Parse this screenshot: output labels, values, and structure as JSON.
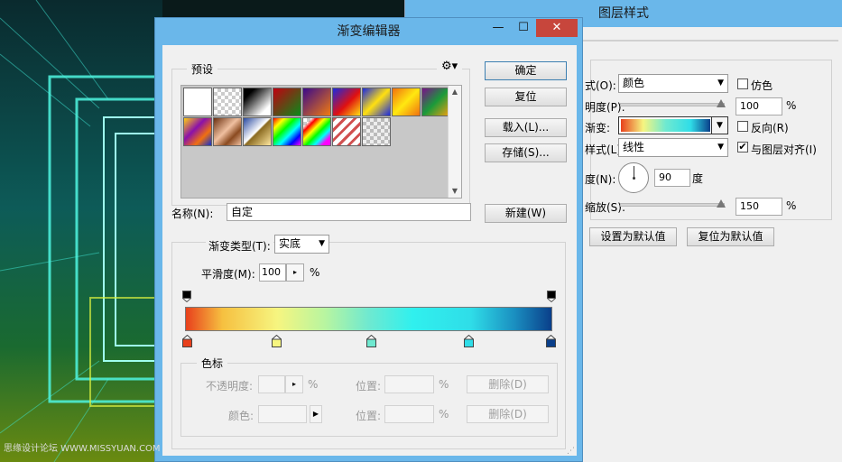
{
  "layer_style": {
    "title": "图层样式",
    "blend_mode_label": "式(O):",
    "blend_mode_value": "颜色",
    "dither_label": "仿色",
    "opacity_label": "明度(P):",
    "opacity_value": "100",
    "percent": "%",
    "gradient_label": "渐变:",
    "reverse_label": "反向(R)",
    "style_label": "样式(L):",
    "style_value": "线性",
    "align_label": "与图层对齐(I)",
    "angle_label": "度(N):",
    "angle_value": "90",
    "degree_unit": "度",
    "scale_label": "缩放(S):",
    "scale_value": "150",
    "set_default_label": "设置为默认值",
    "reset_default_label": "复位为默认值",
    "dither_checked": false,
    "reverse_checked": false,
    "align_checked": true
  },
  "gradient_editor": {
    "title": "渐变编辑器",
    "minimize": "—",
    "maximize": "☐",
    "close": "✕",
    "presets_label": "预设",
    "gear_icon": "gear-icon",
    "ok_label": "确定",
    "reset_label": "复位",
    "load_label": "载入(L)...",
    "save_label": "存储(S)...",
    "name_label": "名称(N):",
    "name_value": "自定",
    "new_label": "新建(W)",
    "gradient_type_label": "渐变类型(T):",
    "gradient_type_value": "实底",
    "smoothness_label": "平滑度(M):",
    "smoothness_value": "100",
    "percent": "%",
    "color_stops_label": "色标",
    "opacity_label": "不透明度:",
    "location_label": "位置:",
    "delete_label": "删除(D)",
    "color_label": "颜色:",
    "presets": [
      "black-white",
      "transparent",
      "black-white-2",
      "red-green",
      "violet-orange",
      "blue-red-yellow",
      "blue-yellow-blue",
      "orange-yellow-orange",
      "violet-green-orange",
      "yellow-violet-orange-blue",
      "copper",
      "chrome",
      "spectrum",
      "transparent-rainbow",
      "transparent-stripes",
      "checker-transparent"
    ],
    "stop_colors": [
      "#e8401c",
      "#f6f580",
      "#6fe9d0",
      "#2fdde8",
      "#0a3f8a"
    ]
  },
  "watermark": "思缘设计论坛 WWW.MISSYUAN.COM"
}
